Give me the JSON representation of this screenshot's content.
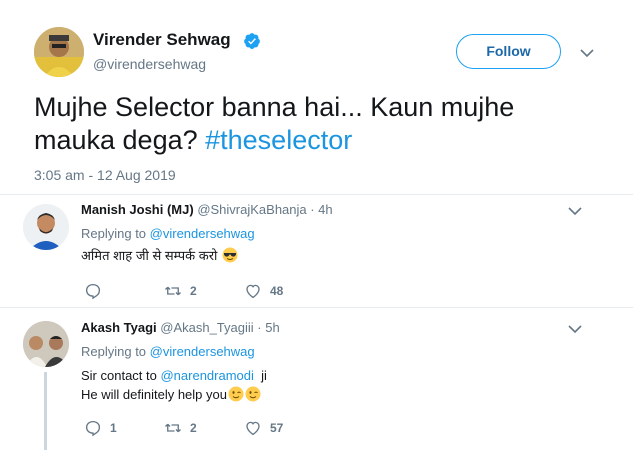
{
  "main_tweet": {
    "author_name": "Virender Sehwag",
    "handle": "@virendersehwag",
    "follow_label": "Follow",
    "text_line1": "Mujhe Selector banna hai... Kaun mujhe",
    "text_line2_prefix": "mauka dega? ",
    "hashtag": "#theselector",
    "timestamp": "3:05 am - 12 Aug 2019"
  },
  "replies": [
    {
      "name": "Manish Joshi (MJ)",
      "meta": "@ShivrajKaBhanja · 4h",
      "replying_prefix": "Replying to ",
      "replying_to": "@virendersehwag",
      "text": "अमित शाह जी से सम्पर्क करो",
      "emoji_icon": "sunglasses-emoji",
      "counts": {
        "replies": "",
        "retweets": "2",
        "likes": "48"
      }
    },
    {
      "name": "Akash Tyagi",
      "meta": "@Akash_Tyagiii · 5h",
      "replying_prefix": "Replying to ",
      "replying_to": "@virendersehwag",
      "text_line1_prefix": "Sir contact to ",
      "text_line1_mention": "@narendramodi",
      "text_line1_suffix": "  ji",
      "text_line2": "He will definitely help you",
      "emoji_icon": "winking-face-emoji",
      "counts": {
        "replies": "1",
        "retweets": "2",
        "likes": "57"
      }
    }
  ],
  "colors": {
    "accent": "#1da1f2",
    "link": "#1b95e0",
    "muted": "#657786",
    "like": "#657786",
    "verified": "#1da1f2"
  }
}
